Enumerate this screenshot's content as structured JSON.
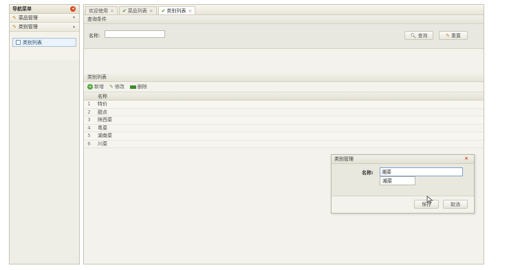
{
  "sidebar": {
    "title": "导航菜单",
    "panels": [
      {
        "label": "菜品管理",
        "arrow": "▾"
      },
      {
        "label": "类别管理",
        "arrow": "▴"
      }
    ],
    "active_item": "类别列表"
  },
  "tabs": [
    {
      "label": "欢迎使用",
      "check": false
    },
    {
      "label": "菜品列表",
      "check": true
    },
    {
      "label": "类别列表",
      "check": true,
      "active": true
    }
  ],
  "query": {
    "title": "查询条件",
    "name_label": "名称:",
    "name_value": "",
    "search_label": "查询",
    "reset_label": "重置"
  },
  "list": {
    "title": "类别列表",
    "toolbar": {
      "add": "新增",
      "edit": "修改",
      "delete": "删除"
    },
    "column_name": "名称",
    "rows": [
      {
        "idx": "1",
        "name": "特价"
      },
      {
        "idx": "2",
        "name": "甜点"
      },
      {
        "idx": "3",
        "name": "陕西菜"
      },
      {
        "idx": "4",
        "name": "粤菜"
      },
      {
        "idx": "5",
        "name": "湖南菜"
      },
      {
        "idx": "6",
        "name": "川菜"
      }
    ]
  },
  "dialog": {
    "title": "类别管理",
    "close": "×",
    "name_label": "名称:",
    "name_value": "湘菜",
    "suggestion": "湘菜",
    "save_label": "保存",
    "cancel_label": "取消"
  }
}
